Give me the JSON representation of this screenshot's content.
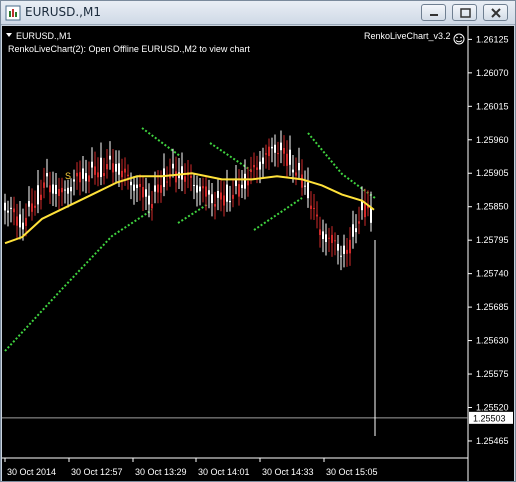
{
  "window": {
    "title": "EURUSD.,M1",
    "minimize_icon": "minimize-icon",
    "maximize_icon": "maximize-icon",
    "close_icon": "close-icon"
  },
  "chart": {
    "symbol_label": "EURUSD.,M1",
    "info_line": "RenkoLiveChart(2): Open Offline EURUSD.,M2 to view chart",
    "indicator_label": "RenkoLiveChart_v3.2",
    "marker_label": "S",
    "current_price": "1.25503",
    "colors": {
      "background": "#000000",
      "bull_candle": "#ffffff",
      "bear_candle": "#d12a2a",
      "ma_line": "#ffe23a",
      "dotted_line": "#3fd23f",
      "axis_text": "#ffffff",
      "marker": "#ffd23a"
    }
  },
  "chart_data": {
    "type": "candlestick",
    "price_axis_ticks": [
      "1.26125",
      "1.26070",
      "1.26015",
      "1.25960",
      "1.25905",
      "1.25850",
      "1.25795",
      "1.25740",
      "1.25685",
      "1.25630",
      "1.25575",
      "1.25520",
      "1.25465"
    ],
    "time_axis_ticks": [
      "30 Oct 2014",
      "30 Oct 12:57",
      "30 Oct 13:29",
      "30 Oct 14:01",
      "30 Oct 14:33",
      "30 Oct 15:05"
    ],
    "ylim": [
      1.25437,
      1.26147
    ],
    "current_price": 1.25503
  }
}
